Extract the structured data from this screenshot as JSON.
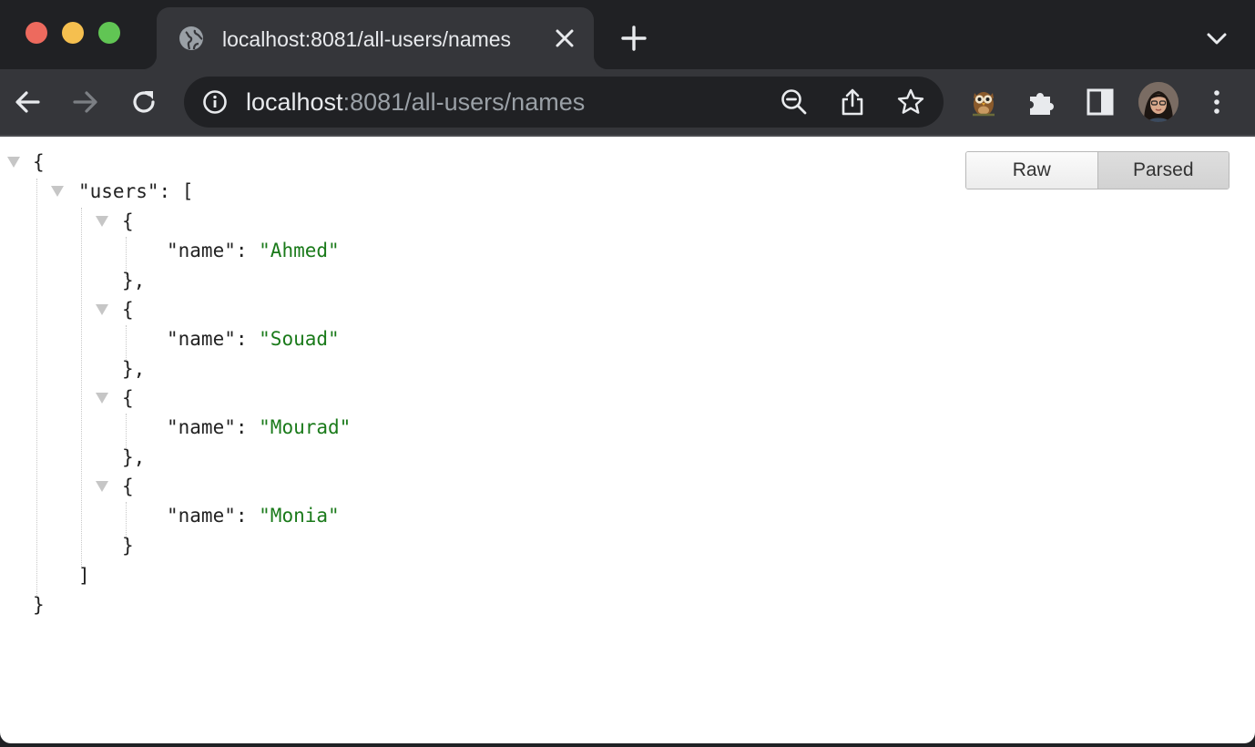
{
  "window": {
    "tab_title": "localhost:8081/all-users/names"
  },
  "toolbar": {
    "url_host": "localhost",
    "url_rest": ":8081/all-users/names"
  },
  "viewer": {
    "raw_label": "Raw",
    "parsed_label": "Parsed",
    "active_mode": "Parsed"
  },
  "json": {
    "root_key": "\"users\"",
    "entry_key": "\"name\"",
    "users": [
      "\"Ahmed\"",
      "\"Souad\"",
      "\"Mourad\"",
      "\"Monia\""
    ]
  },
  "colors": {
    "string_value": "#1a7a1a",
    "chrome_dark": "#202124",
    "chrome_toolbar": "#35363a"
  }
}
